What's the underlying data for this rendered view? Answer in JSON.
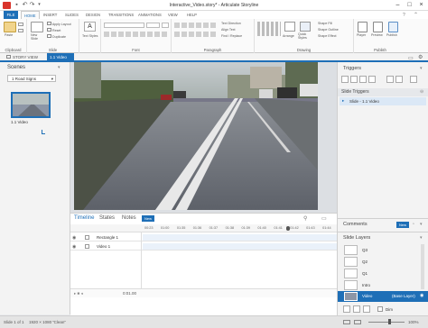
{
  "window": {
    "title": "Interactive_Video.story* - Articulate Storyline"
  },
  "ribbon_tabs": [
    "FILE",
    "HOME",
    "INSERT",
    "SLIDES",
    "DESIGN",
    "TRANSITIONS",
    "ANIMATIONS",
    "VIEW",
    "HELP"
  ],
  "ribbon": {
    "clipboard": {
      "paste": "Paste",
      "label": "Clipboard"
    },
    "slide": {
      "new_slide": "New Slide",
      "apply_layout": "Apply Layout",
      "reset": "Reset",
      "duplicate": "Duplicate",
      "label": "Slide"
    },
    "font": {
      "label": "Font"
    },
    "text": {
      "text_styles": "Text Styles"
    },
    "paragraph": {
      "text_direction": "Text Direction",
      "align_text": "Align Text",
      "convert": "Find / Replace",
      "label": "Paragraph"
    },
    "drawing": {
      "arrange": "Arrange",
      "quick_styles": "Quick Styles",
      "shape_fill": "Shape Fill",
      "shape_outline": "Shape Outline",
      "shape_effect": "Shape Effect",
      "label": "Drawing"
    },
    "publish": {
      "player": "Player",
      "preview": "Preview",
      "publish": "Publish",
      "label": "Publish"
    }
  },
  "view_tabs": {
    "story_view": "STORY VIEW",
    "slide": "1.1 Video"
  },
  "scenes": {
    "title": "Scenes",
    "dropdown": "1 Road Signs",
    "slide_label": "1.1 Video"
  },
  "timeline": {
    "tabs": [
      "Timeline",
      "States",
      "Notes"
    ],
    "badge": "New",
    "ticks": [
      "00:23",
      "01:00",
      "01:35",
      "01:36",
      "01:37",
      "01:38",
      "01:39",
      "01:40",
      "01:41",
      "01:42",
      "01:43",
      "01:44"
    ],
    "rows": [
      {
        "name": "Rectangle 1"
      },
      {
        "name": "Video 1"
      }
    ],
    "time_readout": "0:01.00"
  },
  "triggers": {
    "title": "Triggers",
    "section": "Slide Triggers",
    "item": "Slide - 1.1 Video"
  },
  "comments": {
    "title": "Comments",
    "badge": "New"
  },
  "slide_layers": {
    "title": "Slide Layers",
    "layers": [
      {
        "name": "Q3"
      },
      {
        "name": "Q2"
      },
      {
        "name": "Q1"
      },
      {
        "name": "Intro"
      }
    ],
    "base": {
      "name": "Video",
      "tag": "(Base Layer)"
    },
    "dim_label": "Dim"
  },
  "status": {
    "slide": "Slide 1 of 1",
    "size": "1920 × 1080",
    "theme": "\"Clean\"",
    "zoom": "100%"
  },
  "colors": {
    "accent": "#1e6fb7",
    "file_tab": "#1e6fb7",
    "logo": "#d9342b"
  }
}
